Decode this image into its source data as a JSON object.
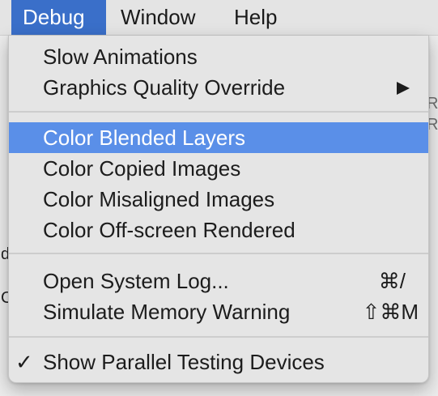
{
  "menubar": {
    "items": [
      {
        "label": "Debug"
      },
      {
        "label": "Window"
      },
      {
        "label": "Help"
      }
    ]
  },
  "background_fragments": [
    "R",
    "R",
    "d",
    "C"
  ],
  "menu": {
    "items": [
      {
        "label": "Slow Animations"
      },
      {
        "label": "Graphics Quality Override",
        "submenu": true
      },
      {
        "label": "Color Blended Layers",
        "highlighted": true
      },
      {
        "label": "Color Copied Images"
      },
      {
        "label": "Color Misaligned Images"
      },
      {
        "label": "Color Off-screen Rendered"
      },
      {
        "label": "Open System Log...",
        "shortcut": "⌘/"
      },
      {
        "label": "Simulate Memory Warning",
        "shortcut": "⇧⌘M"
      },
      {
        "label": "Show Parallel Testing Devices",
        "checked": true,
        "check_mark": "✓"
      }
    ]
  },
  "colors": {
    "active_menubar_item": "#3a6fc9",
    "highlighted_item": "#5a8fe8",
    "menu_background": "#e5e5e5",
    "text": "#1c1c1c"
  },
  "icons": {
    "submenu": "chevron-right-icon",
    "checkmark": "checkmark-icon"
  }
}
